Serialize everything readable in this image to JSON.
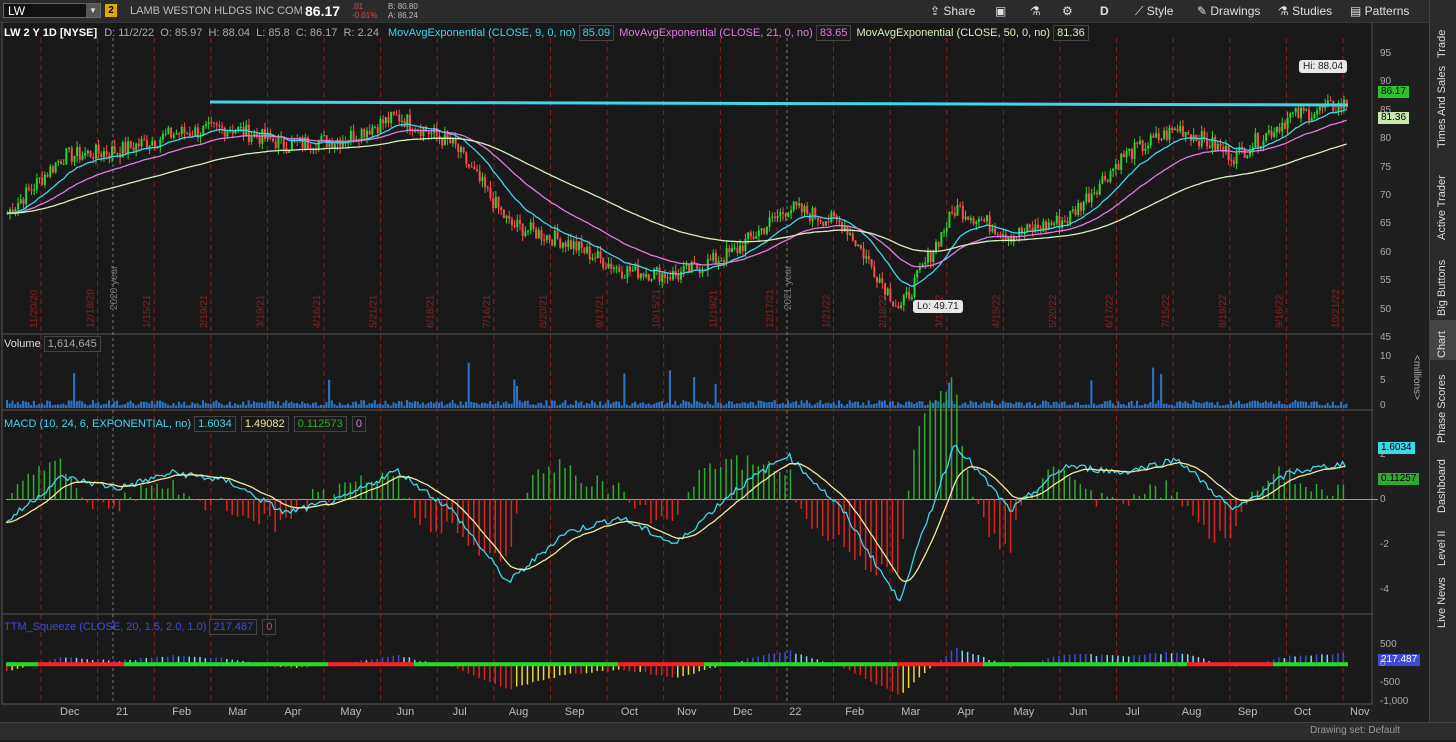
{
  "header": {
    "symbol": "LW",
    "symbol_badge": "2",
    "company": "LAMB WESTON HLDGS INC COM",
    "last": "86.17",
    "change": ".01",
    "change_pct": "-0.01%",
    "bid": "B: 80.80",
    "ask": "A: 86.24"
  },
  "toolbar": {
    "share": "Share",
    "period": "D",
    "style": "Style",
    "drawings": "Drawings",
    "studies": "Studies",
    "patterns": "Patterns"
  },
  "price_panel": {
    "title": "LW 2 Y 1D [NYSE]",
    "date": "D: 11/2/22",
    "open": "O: 85.97",
    "high": "H: 88.04",
    "low": "L: 85.8",
    "close": "C: 86.17",
    "range": "R: 2.24",
    "ema9": "MovAvgExponential (CLOSE, 9, 0, no)",
    "ema9_val": "85.09",
    "ema21": "MovAvgExponential (CLOSE, 21, 0, no)",
    "ema21_val": "83.65",
    "ema50": "MovAvgExponential (CLOSE, 50, 0, no)",
    "ema50_val": "81.36",
    "hi_callout": "Hi: 88.04",
    "lo_callout": "Lo: 49.71",
    "price_tag": "86.17",
    "ema_tag": "81.36",
    "yticks": [
      "95",
      "90",
      "85",
      "80",
      "75",
      "70",
      "65",
      "60",
      "55",
      "50",
      "45"
    ],
    "year_labels": [
      "2020 year",
      "2021 year"
    ],
    "date_labels": [
      "11/20/20",
      "12/18/20",
      "1/15/21",
      "2/19/21",
      "3/19/21",
      "4/16/21",
      "5/21/21",
      "6/18/21",
      "7/16/21",
      "8/20/21",
      "9/17/21",
      "10/15/21",
      "11/19/21",
      "12/17/21",
      "1/21/22",
      "2/18/22",
      "3/18/22",
      "4/15/22",
      "5/20/22",
      "6/17/22",
      "7/15/22",
      "8/19/22",
      "9/16/22",
      "10/21/22"
    ]
  },
  "volume_panel": {
    "title": "Volume",
    "value": "1,614,645",
    "yticks": [
      "10",
      "5",
      "0"
    ],
    "unit": "<millions>"
  },
  "macd_panel": {
    "title": "MACD (10, 24, 6, EXPONENTIAL, no)",
    "v1": "1.6034",
    "v2": "1.49082",
    "v3": "0.112573",
    "v4": "0",
    "yticks": [
      "2",
      "0",
      "-2",
      "-4"
    ],
    "tag1": "1.6034",
    "tag2": "0.11257"
  },
  "ttm_panel": {
    "title": "TTM_Squeeze (CLOSE, 20, 1.5, 2.0, 1.0)",
    "v1": "217.487",
    "v2": "0",
    "yticks": [
      "500",
      "0",
      "-500",
      "-1,000"
    ],
    "tag": "217.487"
  },
  "xaxis": [
    "Dec",
    "21",
    "Feb",
    "Mar",
    "Apr",
    "May",
    "Jun",
    "Jul",
    "Aug",
    "Sep",
    "Oct",
    "Nov",
    "Dec",
    "22",
    "Feb",
    "Mar",
    "Apr",
    "May",
    "Jun",
    "Jul",
    "Aug",
    "Sep",
    "Oct",
    "Nov"
  ],
  "right_tabs": [
    "Trade",
    "Times And Sales",
    "Active Trader",
    "Big Buttons",
    "Chart",
    "Phase Scores",
    "Dashboard",
    "Level II",
    "Live News"
  ],
  "status": {
    "drawing_set": "Drawing set: Default"
  },
  "chart_data": [
    {
      "type": "line",
      "name": "LW price (candlestick) with EMA 9/21/50",
      "x_range": [
        "2020-11",
        "2022-11"
      ],
      "ylim": [
        45,
        95
      ],
      "x": [
        "2020-11",
        "2020-12",
        "2021-01",
        "2021-02",
        "2021-03",
        "2021-04",
        "2021-05",
        "2021-06",
        "2021-07",
        "2021-08",
        "2021-09",
        "2021-10",
        "2021-11",
        "2021-12",
        "2022-01",
        "2022-02",
        "2022-03",
        "2022-04",
        "2022-05",
        "2022-06",
        "2022-07",
        "2022-08",
        "2022-09",
        "2022-10",
        "2022-11"
      ],
      "series": [
        {
          "name": "close",
          "values": [
            67,
            77,
            78,
            81,
            82,
            79,
            80,
            84,
            79,
            65,
            62,
            57,
            56,
            60,
            68,
            65,
            50,
            68,
            63,
            66,
            77,
            82,
            77,
            84,
            86.17
          ]
        }
      ],
      "annotations": [
        "Hi: 88.04",
        "Lo: 49.71",
        "horizontal resistance line ~84"
      ]
    },
    {
      "type": "bar",
      "name": "Volume",
      "ylim": [
        0,
        12
      ],
      "unit": "millions",
      "last": 1614645
    },
    {
      "type": "line",
      "name": "MACD (10,24,6)",
      "ylim": [
        -5,
        3
      ],
      "series": [
        {
          "name": "value",
          "values": [
            -1,
            1,
            0.5,
            1.2,
            0.8,
            -0.6,
            0,
            1.3,
            -0.5,
            -3.7,
            -1.5,
            -0.8,
            -2,
            0.3,
            2,
            -0.5,
            -4.5,
            2.5,
            -0.5,
            1.5,
            1.2,
            1.8,
            -0.5,
            1.2,
            1.6034
          ]
        }
      ]
    },
    {
      "type": "bar",
      "name": "TTM_Squeeze",
      "ylim": [
        -1000,
        800
      ],
      "last": 217.487
    }
  ]
}
